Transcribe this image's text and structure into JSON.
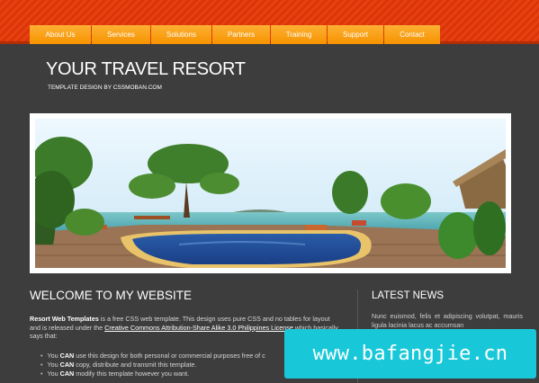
{
  "nav": {
    "items": [
      "About Us",
      "Services",
      "Solutions",
      "Partners",
      "Training",
      "Support",
      "Contact"
    ]
  },
  "header": {
    "title": "YOUR TRAVEL RESORT",
    "subtitle": "TEMPLATE DESIGN BY CSSMOBAN.COM"
  },
  "banner": {
    "image": "resort-pool-photo"
  },
  "welcome": {
    "heading": "WELCOME TO MY WEBSITE",
    "intro_strong": "Resort Web Templates",
    "intro_text_1": " is a free CSS web template. This design uses pure CSS and no tables for layout and is released under the ",
    "license_link": "Creative Commons Attribution-Share Alike 3.0 Philippines License",
    "intro_text_2": " which basically says that:",
    "bullets": [
      {
        "prefix": "You ",
        "strong": "CAN",
        "rest": " use this design for both personal or commercial purposes free of c"
      },
      {
        "prefix": "You ",
        "strong": "CAN",
        "rest": " copy, distribute and transmit this template."
      },
      {
        "prefix": "You ",
        "strong": "CAN",
        "rest": " modify this template however you want."
      }
    ]
  },
  "news": {
    "heading": "LATEST NEWS",
    "text": "Nunc euismod, felis et adipiscing volutpat, mauris ligula lacinia lacus ac accumsan"
  },
  "watermark": {
    "text": "www.bafangjie.cn"
  },
  "colors": {
    "topbar": "#e8400f",
    "nav_button": "#fba21e",
    "page_bg": "#3d3d3d",
    "watermark_bg": "#19c8d8"
  }
}
